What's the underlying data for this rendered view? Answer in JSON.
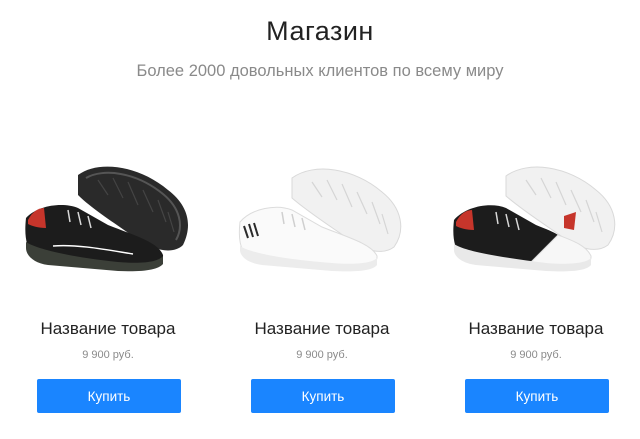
{
  "header": {
    "title": "Магазин",
    "subtitle": "Более 2000 довольных клиентов по всему миру"
  },
  "products": [
    {
      "name": "Название товара",
      "price": "9 900 руб.",
      "buy_label": "Купить",
      "image": "black-red-sneaker"
    },
    {
      "name": "Название товара",
      "price": "9 900 руб.",
      "buy_label": "Купить",
      "image": "white-sneaker"
    },
    {
      "name": "Название товара",
      "price": "9 900 руб.",
      "buy_label": "Купить",
      "image": "black-white-red-sneaker"
    }
  ],
  "colors": {
    "accent": "#1a85ff",
    "title": "#222222",
    "muted": "#8a8a8a"
  }
}
